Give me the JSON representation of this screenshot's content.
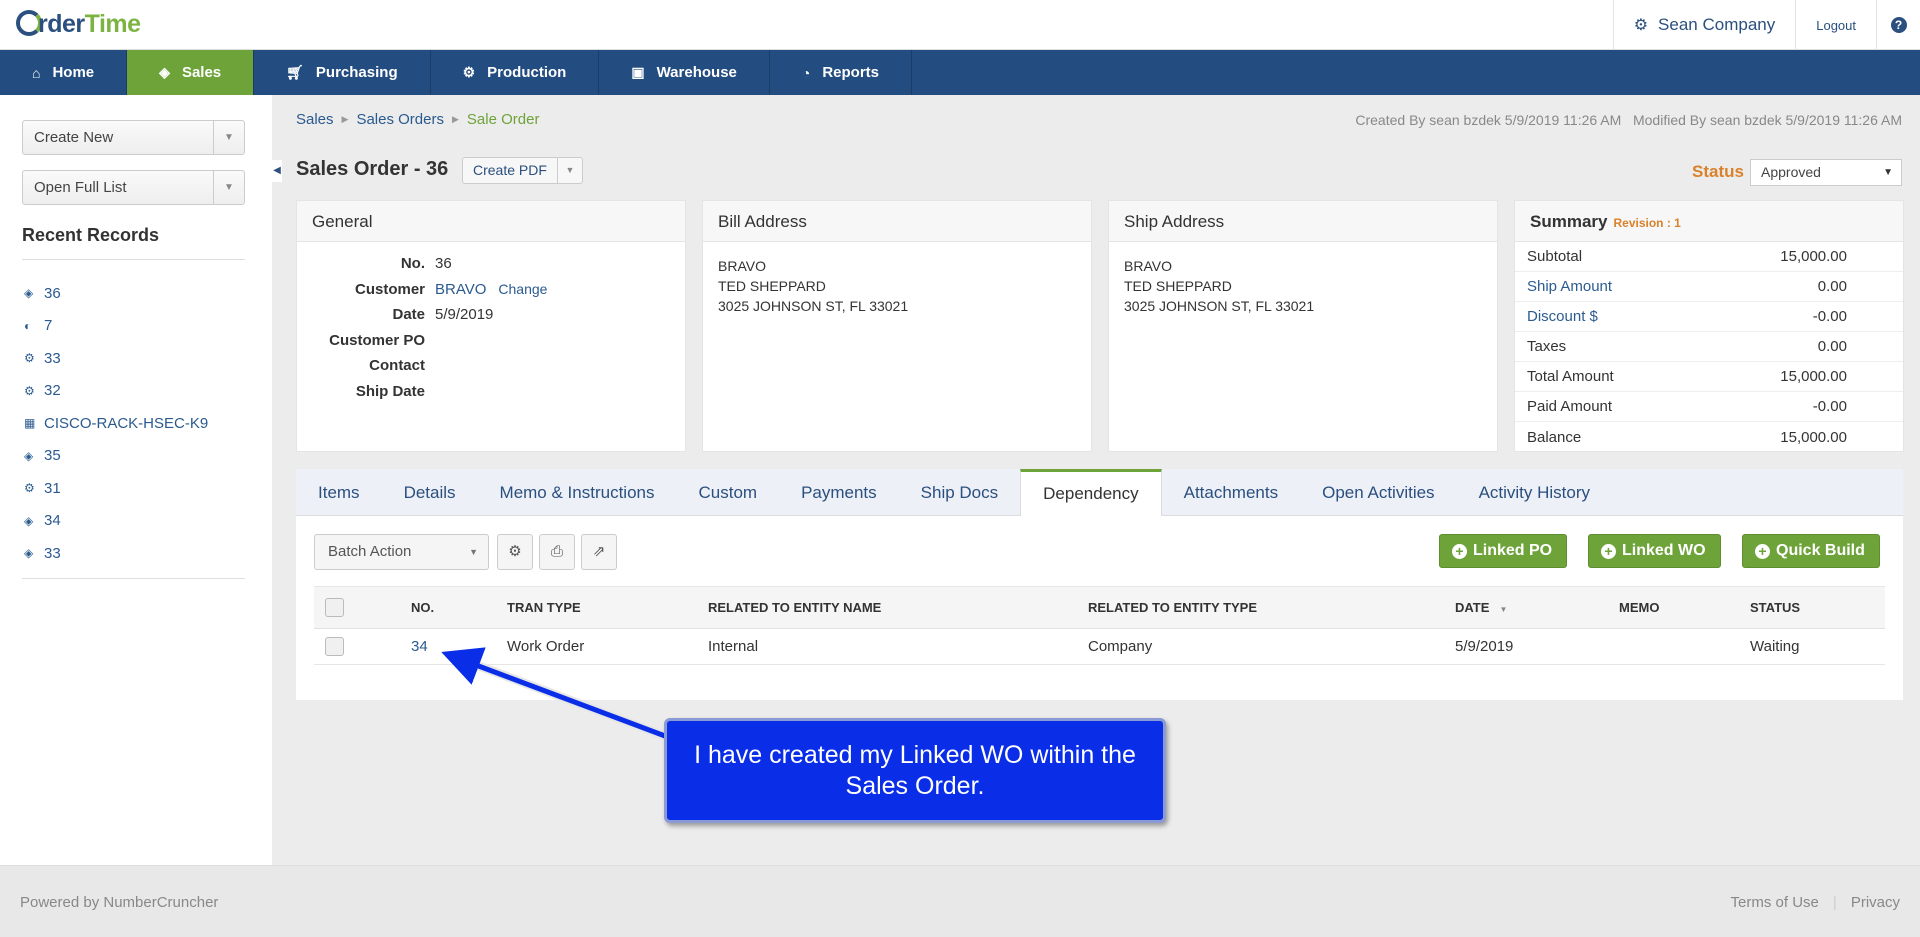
{
  "app": {
    "logo_part1": "rder",
    "logo_part2": "Time",
    "company": "Sean Company",
    "logout": "Logout",
    "help": "?"
  },
  "nav": [
    {
      "label": "Home",
      "icon": "home-icon"
    },
    {
      "label": "Sales",
      "icon": "tag-icon",
      "active": true
    },
    {
      "label": "Purchasing",
      "icon": "cart-icon"
    },
    {
      "label": "Production",
      "icon": "gears-icon"
    },
    {
      "label": "Warehouse",
      "icon": "box-icon"
    },
    {
      "label": "Reports",
      "icon": "pie-chart-icon"
    }
  ],
  "sidebar": {
    "create_new": "Create New",
    "open_full_list": "Open Full List",
    "recent_title": "Recent Records",
    "recent": [
      {
        "label": "36",
        "icon": "tag-icon"
      },
      {
        "label": "7",
        "icon": "half-circle-icon"
      },
      {
        "label": "33",
        "icon": "gear-icon"
      },
      {
        "label": "32",
        "icon": "gear-icon"
      },
      {
        "label": "CISCO-RACK-HSEC-K9",
        "icon": "grid-icon"
      },
      {
        "label": "35",
        "icon": "tag-icon"
      },
      {
        "label": "31",
        "icon": "gear-icon"
      },
      {
        "label": "34",
        "icon": "tag-icon"
      },
      {
        "label": "33",
        "icon": "tag-icon"
      }
    ]
  },
  "breadcrumb": [
    "Sales",
    "Sales Orders",
    "Sale Order"
  ],
  "meta": {
    "created": "Created By sean bzdek 5/9/2019 11:26 AM",
    "modified": "Modified By sean bzdek 5/9/2019 11:26 AM"
  },
  "header": {
    "title": "Sales Order - 36",
    "create_pdf": "Create PDF",
    "status_label": "Status",
    "status_value": "Approved"
  },
  "general": {
    "title": "General",
    "no_label": "No.",
    "no_value": "36",
    "customer_label": "Customer",
    "customer_value": "BRAVO",
    "customer_change": "Change",
    "date_label": "Date",
    "date_value": "5/9/2019",
    "customer_po_label": "Customer PO",
    "contact_label": "Contact",
    "ship_date_label": "Ship Date"
  },
  "bill_address": {
    "title": "Bill Address",
    "line1": "BRAVO",
    "line2": "TED SHEPPARD",
    "line3": "3025 JOHNSON ST, FL 33021"
  },
  "ship_address": {
    "title": "Ship Address",
    "line1": "BRAVO",
    "line2": "TED SHEPPARD",
    "line3": "3025 JOHNSON ST, FL 33021"
  },
  "summary": {
    "title": "Summary",
    "revision": "Revision : 1",
    "rows": [
      {
        "label": "Subtotal",
        "value": "15,000.00"
      },
      {
        "label": "Ship Amount",
        "value": "0.00"
      },
      {
        "label": "Discount $",
        "value": "-0.00"
      },
      {
        "label": "Taxes",
        "value": "0.00"
      },
      {
        "label": "Total Amount",
        "value": "15,000.00"
      },
      {
        "label": "Paid Amount",
        "value": "-0.00"
      },
      {
        "label": "Balance",
        "value": "15,000.00"
      }
    ]
  },
  "tabs": [
    "Items",
    "Details",
    "Memo & Instructions",
    "Custom",
    "Payments",
    "Ship Docs",
    "Dependency",
    "Attachments",
    "Open Activities",
    "Activity History"
  ],
  "toolbar": {
    "batch_action": "Batch Action",
    "linked_po": "Linked PO",
    "linked_wo": "Linked WO",
    "quick_build": "Quick Build"
  },
  "grid": {
    "columns": [
      "NO.",
      "TRAN TYPE",
      "RELATED TO ENTITY NAME",
      "RELATED TO ENTITY TYPE",
      "DATE",
      "MEMO",
      "STATUS"
    ],
    "rows": [
      {
        "no": "34",
        "tran_type": "Work Order",
        "entity_name": "Internal",
        "entity_type": "Company",
        "date": "5/9/2019",
        "memo": "",
        "status": "Waiting"
      }
    ]
  },
  "annotation": {
    "text": "I have created my Linked WO within the Sales Order."
  },
  "footer": {
    "powered": "Powered by NumberCruncher",
    "terms": "Terms of Use",
    "privacy": "Privacy"
  },
  "colors": {
    "nav_bg": "#234c80",
    "accent_green": "#6ea33a",
    "status_orange": "#d9822b",
    "callout_blue": "#0a2de8"
  }
}
